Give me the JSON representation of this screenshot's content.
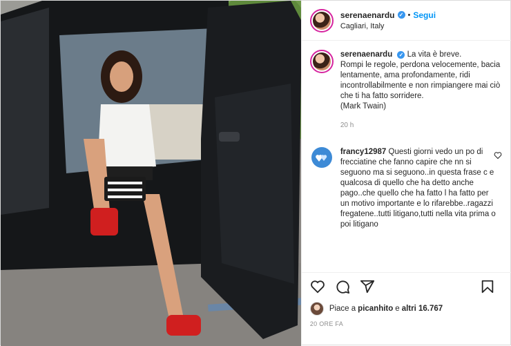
{
  "post": {
    "username": "serenaenardu",
    "follow_label": "Segui",
    "dot": "•",
    "location": "Cagliari, Italy",
    "caption_text": "La vita è breve.\nRompi le regole, perdona velocemente, bacia lentamente, ama profondamente, ridi incontrollabilmente e non rimpiangere mai ciò che ti ha fatto sorridere.\n(Mark Twain)",
    "caption_time": "20 h"
  },
  "comment": {
    "username": "francy12987",
    "text": "Questi giorni vedo un po di frecciatine che fanno capire che nn si seguono ma si seguono..in questa frase c e qualcosa di quello che ha detto anche pago..che quello che ha fatto l ha fatto per un motivo importante e lo rifarebbe..ragazzi fregatene..tutti litigano,tutti nella vita prima o poi litigano"
  },
  "likes": {
    "prefix": "Piace a ",
    "user": "picanhito",
    "middle": " e ",
    "others": "altri 16.767"
  },
  "date": "20 ORE FA",
  "icons": [
    "heart-icon",
    "comment-icon",
    "share-icon",
    "bookmark-icon",
    "verified-icon"
  ],
  "colors": {
    "accent": "#0095f6",
    "verified": "#3897f0",
    "muted": "#8e8e8e"
  }
}
